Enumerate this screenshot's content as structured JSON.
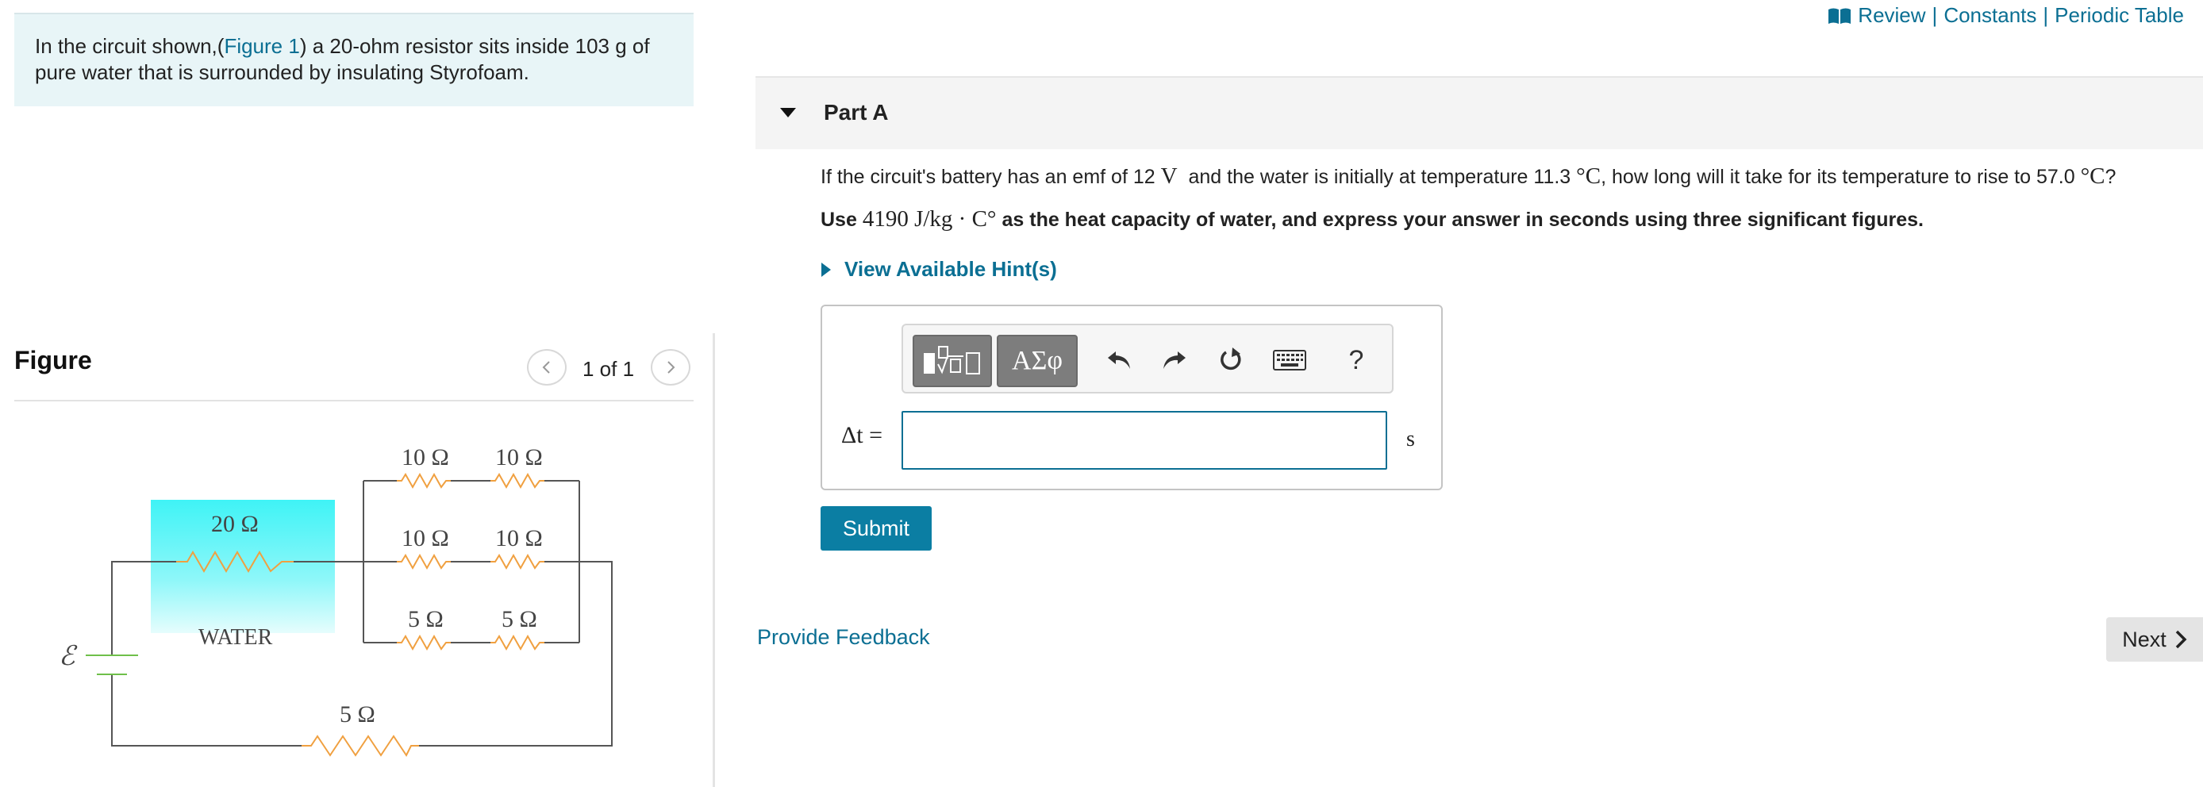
{
  "intro": {
    "text_before": "In the circuit shown,(",
    "figure_link": "Figure 1",
    "text_after": ") a 20-ohm resistor sits inside 103 g of pure water that is surrounded by insulating Styrofoam."
  },
  "figure": {
    "title": "Figure",
    "pager": "1 of 1",
    "circuit": {
      "emf_symbol": "ℰ",
      "water_label": "WATER",
      "water_resistor": "20 Ω",
      "bottom_resistor": "5 Ω",
      "row1_left": "10 Ω",
      "row1_right": "10 Ω",
      "row2_left": "10 Ω",
      "row2_right": "10 Ω",
      "row3_left": "5 Ω",
      "row3_right": "5 Ω"
    }
  },
  "top_links": {
    "review": "Review",
    "constants": "Constants",
    "periodic": "Periodic Table",
    "sep": "|"
  },
  "part": {
    "title": "Part A"
  },
  "question": {
    "t1": "If the circuit's battery has an emf of 12",
    "m1": "V",
    "t2": "and the water is initially at temperature 11.3",
    "m2": "°C",
    "t3": ", how long will it take for its temperature to rise to 57.0",
    "m3": "°C",
    "t4": "?"
  },
  "instruction": {
    "t1": "Use",
    "m1": "4190 J/kg · C°",
    "t2": "as the heat capacity of water, and express your answer in seconds using three significant figures."
  },
  "hint": {
    "label": "View Available Hint(s)"
  },
  "answer": {
    "label": "Δt =",
    "value": "",
    "unit": "s",
    "toolbar": {
      "greek": "ΑΣφ",
      "help": "?"
    }
  },
  "submit_label": "Submit",
  "feedback_label": "Provide Feedback",
  "next_label": "Next",
  "colors": {
    "link": "#0b6f93",
    "water": "#3ff3f6",
    "resistor": "#f0a040",
    "submit": "#0b7ea3"
  }
}
